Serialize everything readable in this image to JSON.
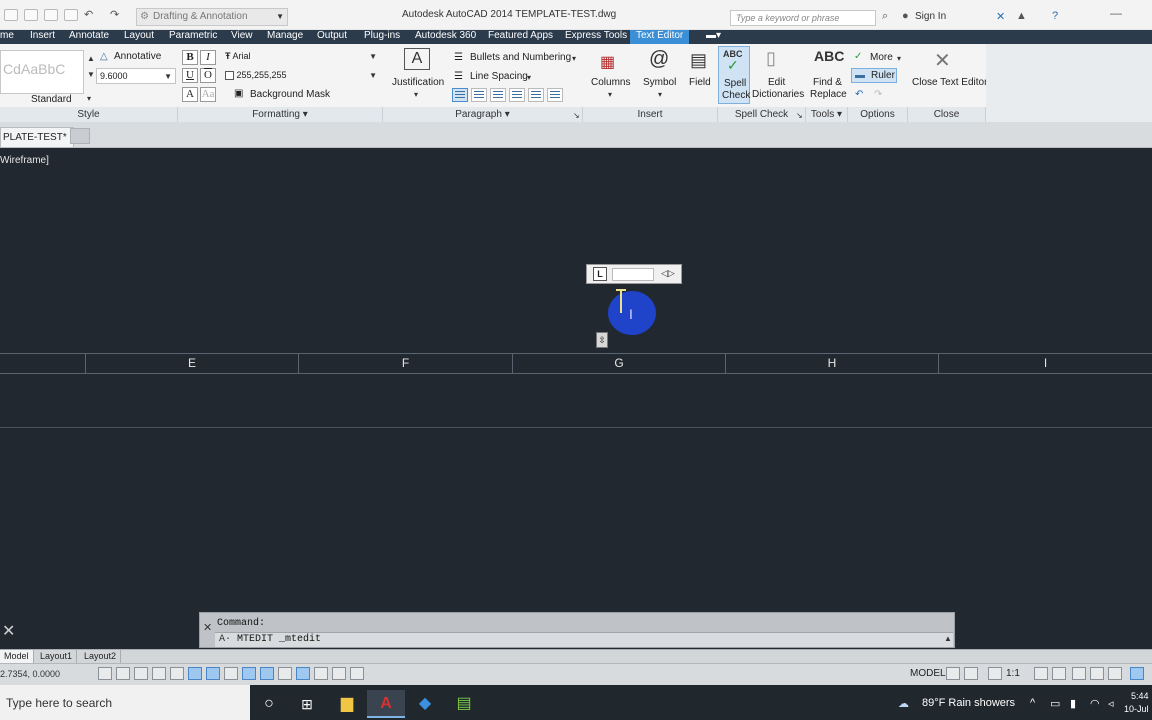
{
  "titlebar": {
    "workspace": "Drafting & Annotation",
    "app_title": "Autodesk AutoCAD 2014     TEMPLATE-TEST.dwg",
    "search_placeholder": "Type a keyword or phrase",
    "sign_in": "Sign In"
  },
  "ribbon_tabs": [
    {
      "label": "me"
    },
    {
      "label": "Insert"
    },
    {
      "label": "Annotate"
    },
    {
      "label": "Layout"
    },
    {
      "label": "Parametric"
    },
    {
      "label": "View"
    },
    {
      "label": "Manage"
    },
    {
      "label": "Output"
    },
    {
      "label": "Plug-ins"
    },
    {
      "label": "Autodesk 360"
    },
    {
      "label": "Featured Apps"
    },
    {
      "label": "Express Tools"
    },
    {
      "label": "Text Editor"
    }
  ],
  "ribbon": {
    "style": {
      "swatch1": "Cd",
      "swatch2": "AaBbC",
      "swatch_label": "Standard",
      "annotative": "Annotative",
      "height": "9.6000",
      "panel": "Style"
    },
    "formatting": {
      "bold": "B",
      "italic": "I",
      "underline": "U",
      "overline": "O",
      "font": "Arial",
      "color": "255,255,255",
      "background_mask": "Background Mask",
      "panel": "Formatting"
    },
    "paragraph": {
      "justification": "Justification",
      "bullets": "Bullets and Numbering",
      "line_spacing": "Line Spacing",
      "panel": "Paragraph"
    },
    "insert": {
      "columns": "Columns",
      "symbol": "Symbol",
      "field": "Field",
      "panel": "Insert"
    },
    "spellcheck": {
      "spell_check_1": "Spell",
      "spell_check_2": "Check",
      "edit_dict_1": "Edit",
      "edit_dict_2": "Dictionaries",
      "panel": "Spell Check"
    },
    "tools": {
      "find_1": "Find &",
      "find_2": "Replace",
      "panel": "Tools"
    },
    "options": {
      "more": "More",
      "ruler": "Ruler",
      "panel": "Options"
    },
    "close": {
      "close_editor": "Close Text Editor",
      "panel": "Close"
    }
  },
  "file_tab": "PLATE-TEST*",
  "viewport_label": "Wireframe]",
  "columns": [
    "E",
    "F",
    "G",
    "H",
    "I"
  ],
  "mtext": {
    "ruler_button": "L"
  },
  "command_line": {
    "history": "Command:",
    "input": "MTEDIT _mtedit"
  },
  "layout_tabs": [
    "Model",
    "Layout1",
    "Layout2"
  ],
  "statusbar": {
    "coords": "2.7354, 0.0000",
    "model": "MODEL",
    "scale": "1:1"
  },
  "taskbar": {
    "search": "Type here to search",
    "weather": "89°F  Rain showers",
    "time": "5:44",
    "date": "10-Jul"
  },
  "colors": {
    "canvas": "#212830",
    "accent": "#3b8fd6",
    "cursor_highlight": "#1f43c9"
  }
}
